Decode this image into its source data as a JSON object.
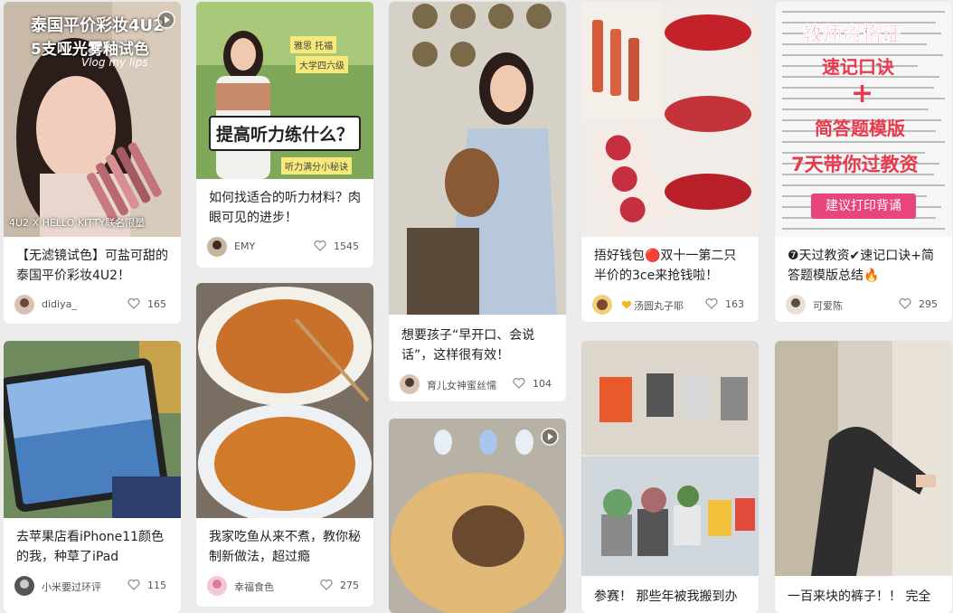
{
  "cards": [
    {
      "title": "【无滤镜试色】可盐可甜的泰国平价彩妆4U2！",
      "author": "didiya_",
      "likes": "165",
      "overlay": {
        "line1": "泰国平价彩妆4U2",
        "line2": "5支哑光雾釉试色",
        "script": "Vlog my lips",
        "bottom": "4U2 X HELLO KITTY联名限量"
      }
    },
    {
      "title": "如何找适合的听力材料？肉眼可见的进步！",
      "author": "EMY",
      "likes": "1545",
      "overlay": {
        "main": "提高听力练什么？",
        "tag1": "雅思 托福",
        "tag2": "大学四六级",
        "tag3": "听力满分小秘诀"
      }
    },
    {
      "title": "想要孩子“早开口、会说话”，这样很有效！",
      "author": "育儿女神蜜丝懦",
      "likes": "104"
    },
    {
      "title": "捂好钱包🔴双十一第二只半价的3ce来抢钱啦！",
      "author": "汤圆丸子耶",
      "likes": "163"
    },
    {
      "title": "❼天过教资✔速记口诀+简答题模版总结🔥",
      "author": "可爱陈",
      "likes": "295",
      "overlay": {
        "line1": "教师资格证",
        "line2": "速记口诀",
        "plus": "+",
        "line3": "简答题模版",
        "line4": "7天带你过教资",
        "button": "建议打印背诵"
      }
    },
    {
      "title": "去苹果店看iPhone11颜色的我，种草了iPad",
      "author": "小米要过环评",
      "likes": "115"
    },
    {
      "title": "我家吃鱼从来不煮，教你秘制新做法，超过瘾",
      "author": "幸福食色",
      "likes": "275"
    },
    {
      "title": ""
    },
    {
      "title": "参赛！ 那些年被我搬到办"
    },
    {
      "title": "一百来块的裤子！！ 完全"
    }
  ],
  "colors": {
    "accent_red": "#e83a4c",
    "pink_button": "#e8457a",
    "heart_stroke": "#8a8a8a"
  }
}
